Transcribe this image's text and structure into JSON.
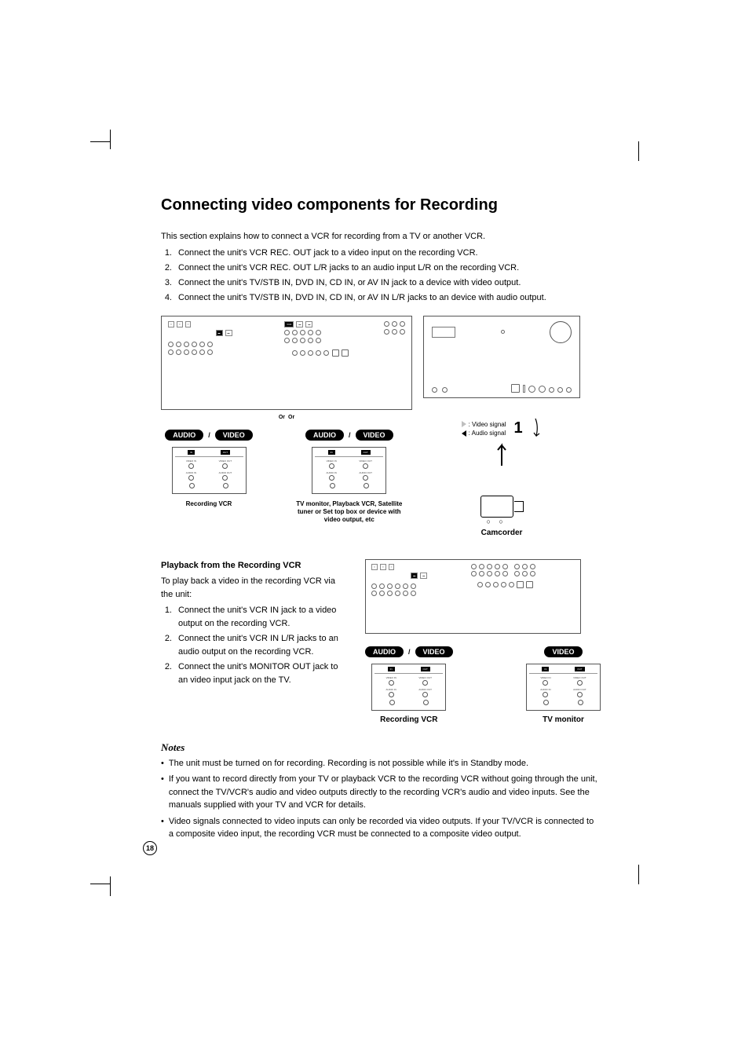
{
  "title": "Connecting video components for Recording",
  "intro": "This section explains how to connect a VCR for recording from a TV or another VCR.",
  "steps": [
    "Connect the unit's VCR REC. OUT jack to a video input on the recording VCR.",
    "Connect the unit's VCR REC. OUT L/R jacks to an audio input L/R on the recording VCR.",
    "Connect the unit's TV/STB IN, DVD IN, CD IN, or AV IN jack to a device with video output.",
    "Connect the unit's TV/STB IN, DVD IN, CD IN, or AV IN L/R jacks to an device with audio output."
  ],
  "diagram1": {
    "or": "Or",
    "audio_pill": "AUDIO",
    "video_pill": "VIDEO",
    "slash": "/",
    "vcr_in": "IN",
    "vcr_out": "OUT",
    "vcr_video_in": "VIDEO IN",
    "vcr_video_out": "VIDEO OUT",
    "vcr_audio_in": "AUDIO IN",
    "vcr_audio_out": "AUDIO OUT",
    "recording_vcr_label": "Recording VCR",
    "playback_label": "TV monitor, Playback VCR, Satellite tuner or Set top box or device with video output, etc",
    "video_signal": ": Video signal",
    "audio_signal": ": Audio signal",
    "one": "1",
    "camcorder": "Camcorder"
  },
  "playback": {
    "heading": "Playback from the Recording VCR",
    "intro": "To play back a video in the recording VCR via the unit:",
    "steps": [
      {
        "n": "1.",
        "t": "Connect the unit's VCR IN jack to a video output on the recording VCR."
      },
      {
        "n": "2.",
        "t": "Connect the unit's VCR IN L/R jacks to an audio output on the recording VCR."
      },
      {
        "n": "2.",
        "t": "Connect the unit's MONITOR OUT jack to an video input jack on the TV."
      }
    ],
    "recording_vcr": "Recording VCR",
    "tv_monitor": "TV monitor"
  },
  "notes": {
    "heading": "Notes",
    "items": [
      "The unit must be turned on for recording. Recording is not possible while it's in Standby mode.",
      "If you want to record directly from your TV or playback VCR to the recording VCR without going through the unit, connect the TV/VCR's audio and video outputs directly to the recording VCR's audio and video inputs. See the manuals supplied with your TV and VCR for details.",
      "Video signals connected to video inputs can only be recorded via video outputs. If your TV/VCR is connected to a composite video input, the recording VCR must be connected to a composite video output."
    ]
  },
  "page_number": "18"
}
